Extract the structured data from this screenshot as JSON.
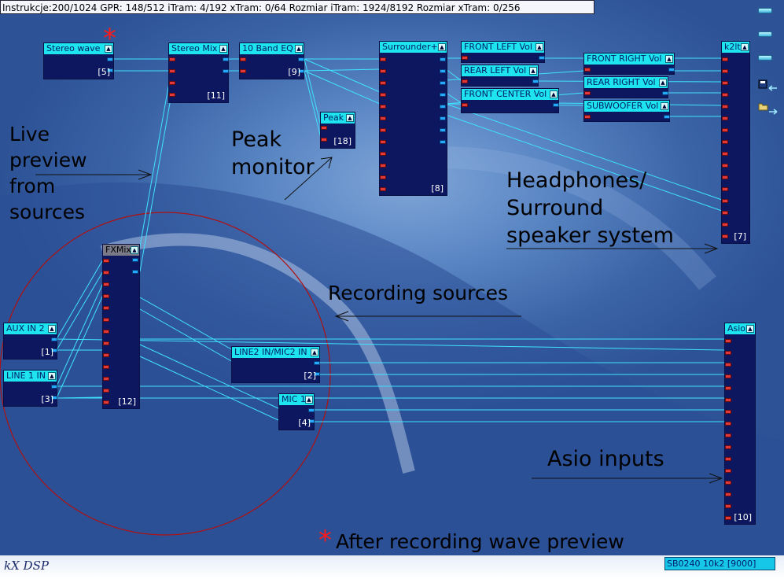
{
  "info_bar": {
    "text": "Instrukcje:200/1024 GPR: 148/512 iTram: 4/192 xTram: 0/64 Rozmiar iTram: 1924/8192 Rozmiar xTram: 0/256"
  },
  "plugins": [
    {
      "id": "stereo-wave",
      "title": "Stereo wave",
      "num": "[5]"
    },
    {
      "id": "stereo-mix",
      "title": "Stereo Mix",
      "num": "[11]"
    },
    {
      "id": "eq10",
      "title": "10 Band EQ",
      "num": "[9]"
    },
    {
      "id": "peak",
      "title": "Peak",
      "num": "[18]"
    },
    {
      "id": "surrounder",
      "title": "Surrounder+",
      "num": "[8]"
    },
    {
      "id": "front-left-vol",
      "title": "FRONT LEFT Vol",
      "num": ""
    },
    {
      "id": "rear-left-vol",
      "title": "REAR LEFT Vol",
      "num": ""
    },
    {
      "id": "front-center-vol",
      "title": "FRONT CENTER Vol",
      "num": ""
    },
    {
      "id": "front-right-vol",
      "title": "FRONT RIGHT Vol",
      "num": ""
    },
    {
      "id": "rear-right-vol",
      "title": "REAR RIGHT Vol",
      "num": ""
    },
    {
      "id": "subwoofer-vol",
      "title": "SUBWOOFER Vol",
      "num": ""
    },
    {
      "id": "k2lt",
      "title": "k2lt",
      "num": "[7]"
    },
    {
      "id": "fxmix",
      "title": "FXMix",
      "num": "[12]"
    },
    {
      "id": "aux-in-2",
      "title": "AUX IN 2",
      "num": "[1]"
    },
    {
      "id": "line-1-in",
      "title": "LINE 1 IN",
      "num": "[3]"
    },
    {
      "id": "line2-mic2-in",
      "title": "LINE2 IN/MIC2 IN",
      "num": "[2]"
    },
    {
      "id": "mic-1",
      "title": "MIC 1",
      "num": "[4]"
    },
    {
      "id": "asio",
      "title": "Asio",
      "num": "[10]"
    }
  ],
  "annotations": {
    "live_preview": [
      "Live",
      "preview",
      "from",
      "sources"
    ],
    "peak_monitor": [
      "Peak",
      "monitor"
    ],
    "headphones": [
      "Headphones/",
      "Surround",
      "speaker system"
    ],
    "recording_sources": "Recording sources",
    "asio_inputs": "Asio inputs",
    "after_recording_star": "*",
    "after_recording": "After recording wave preview",
    "stereo_wave_star": "*"
  },
  "status": {
    "device": "SB0240 10k2 [9000]"
  },
  "logo": "kX DSP",
  "colors": {
    "title_bar": "#1de4ee",
    "plugin_body": "#0d1760",
    "wire": "#3fe2ff",
    "pin_in": "#e23a3a",
    "pin_out": "#25a9ff",
    "star": "#ff1a1a"
  }
}
